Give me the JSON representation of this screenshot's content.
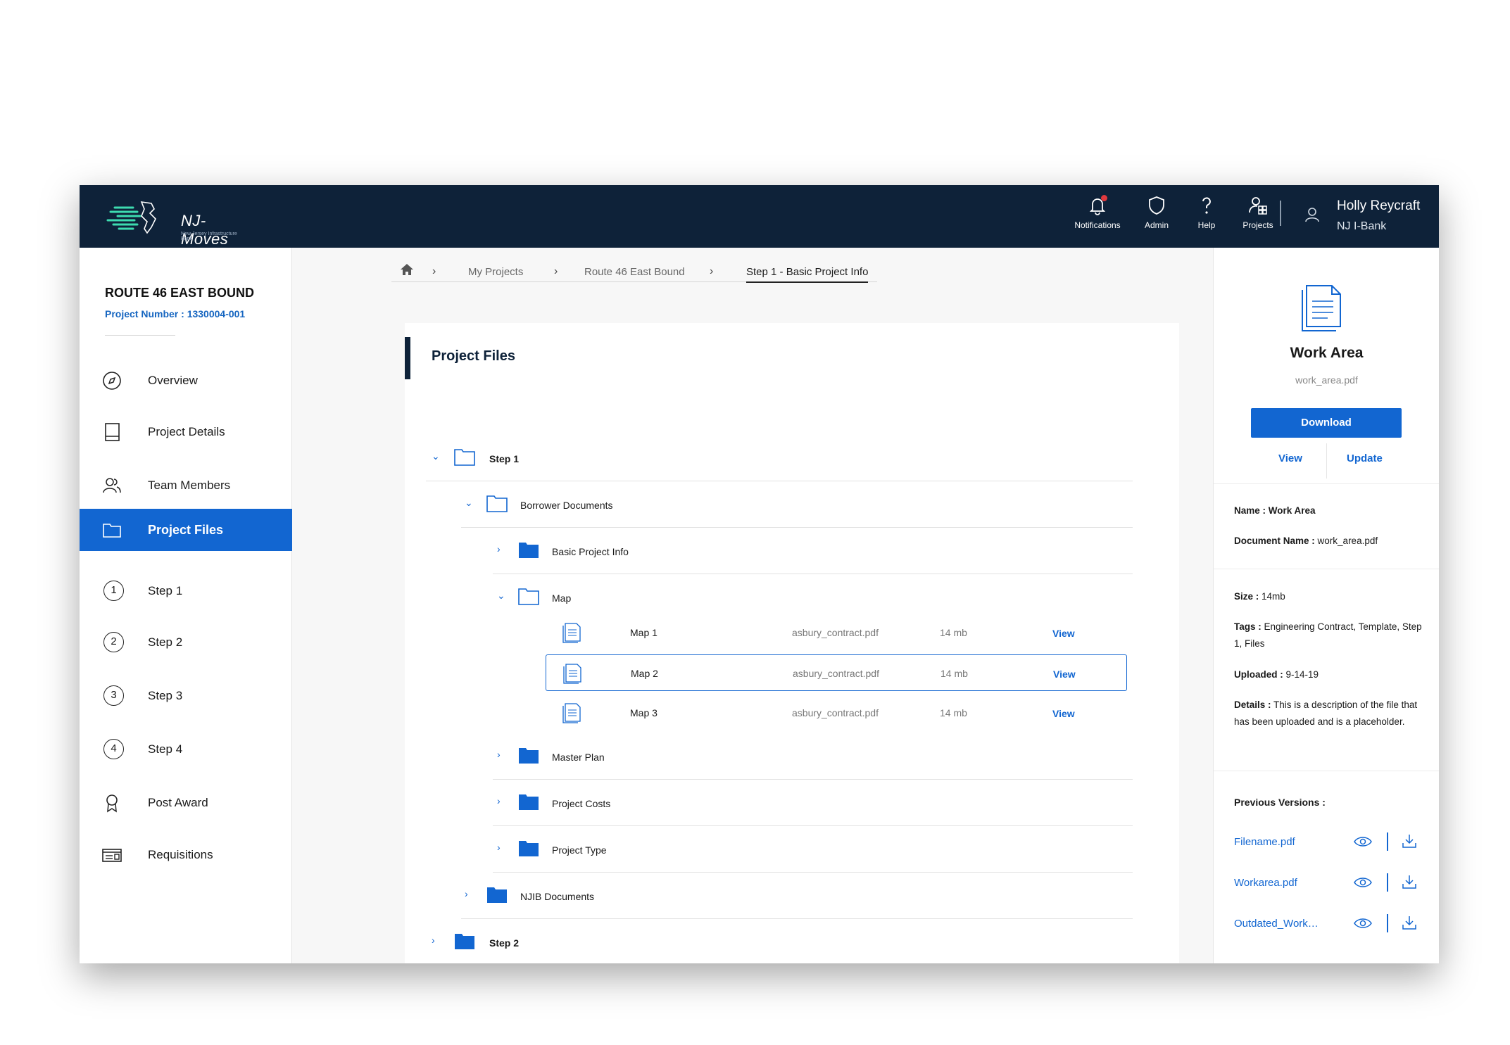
{
  "app": {
    "logo_text": "NJ-Moves",
    "logo_sub": "New Jersey Infrastructure Bank"
  },
  "header": {
    "nav": [
      {
        "label": "Notifications",
        "icon": "bell-icon"
      },
      {
        "label": "Admin",
        "icon": "shield-icon"
      },
      {
        "label": "Help",
        "icon": "question-icon"
      },
      {
        "label": "Projects",
        "icon": "projects-icon"
      }
    ],
    "user": {
      "name": "Holly Reycraft",
      "org": "NJ I-Bank"
    }
  },
  "sidebar": {
    "project_title": "ROUTE 46 EAST BOUND",
    "project_number": "Project Number : 1330004-001",
    "items": [
      {
        "label": "Overview",
        "icon": "compass-icon"
      },
      {
        "label": "Project Details",
        "icon": "book-icon"
      },
      {
        "label": "Team Members",
        "icon": "people-icon"
      },
      {
        "label": "Project Files",
        "icon": "folder-icon",
        "active": true
      },
      {
        "label": "Step 1",
        "num": "1"
      },
      {
        "label": "Step 2",
        "num": "2"
      },
      {
        "label": "Step 3",
        "num": "3"
      },
      {
        "label": "Step 4",
        "num": "4"
      },
      {
        "label": "Post Award",
        "icon": "award-icon"
      },
      {
        "label": "Requisitions",
        "icon": "requisitions-icon"
      }
    ]
  },
  "breadcrumb": {
    "items": [
      "My Projects",
      "Route 46 East Bound",
      "Step 1 - Basic Project Info"
    ]
  },
  "main": {
    "title": "Project Files",
    "tree": {
      "step1": "Step 1",
      "borrower": "Borrower Documents",
      "basic": "Basic Project Info",
      "map": "Map",
      "master": "Master Plan",
      "costs": "Project Costs",
      "type": "Project Type",
      "njib": "NJIB Documents",
      "step2": "Step 2"
    },
    "files": [
      {
        "name": "Map 1",
        "path": "asbury_contract.pdf",
        "size": "14 mb",
        "action": "View"
      },
      {
        "name": "Map 2",
        "path": "asbury_contract.pdf",
        "size": "14 mb",
        "action": "View",
        "selected": true
      },
      {
        "name": "Map 3",
        "path": "asbury_contract.pdf",
        "size": "14 mb",
        "action": "View"
      }
    ]
  },
  "panel": {
    "title": "Work Area",
    "filename": "work_area.pdf",
    "download": "Download",
    "view": "View",
    "update": "Update",
    "name_label": "Name :",
    "name_value": "Work Area",
    "docname_label": "Document Name :",
    "docname_value": "work_area.pdf",
    "size_label": "Size :",
    "size_value": "14mb",
    "tags_label": "Tags :",
    "tags_value": "Engineering Contract, Template, Step 1, Files",
    "uploaded_label": "Uploaded :",
    "uploaded_value": "9-14-19",
    "details_label": "Details :",
    "details_value": "This is a description of the file that has been uploaded and is a placeholder.",
    "prev_title": "Previous Versions :",
    "prev_versions": [
      "Filename.pdf",
      "Workarea.pdf",
      "Outdated_Work…"
    ]
  },
  "colors": {
    "header": "#0e2239",
    "accent": "#1266d1",
    "notification_dot": "#e0393e"
  }
}
